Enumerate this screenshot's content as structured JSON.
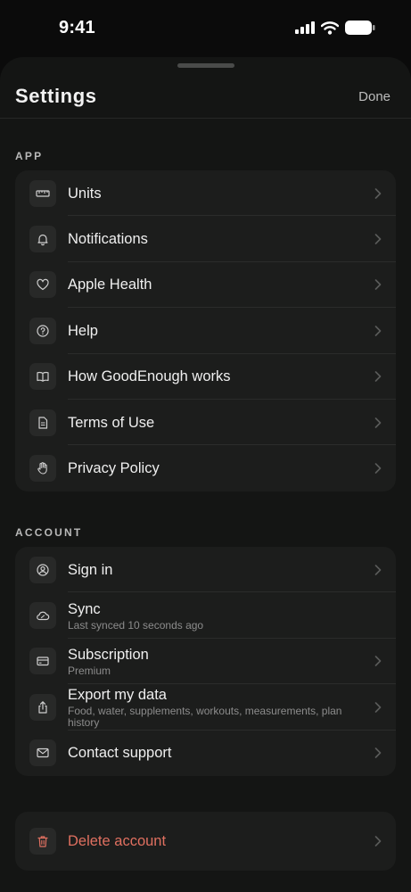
{
  "status": {
    "time": "9:41"
  },
  "header": {
    "title": "Settings",
    "done_label": "Done"
  },
  "sections": {
    "app": {
      "title": "APP",
      "items": [
        {
          "label": "Units",
          "icon": "ruler-icon"
        },
        {
          "label": "Notifications",
          "icon": "bell-icon"
        },
        {
          "label": "Apple Health",
          "icon": "heart-icon"
        },
        {
          "label": "Help",
          "icon": "help-circle-icon"
        },
        {
          "label": "How GoodEnough works",
          "icon": "book-icon"
        },
        {
          "label": "Terms of Use",
          "icon": "document-icon"
        },
        {
          "label": "Privacy Policy",
          "icon": "hand-icon"
        }
      ]
    },
    "account": {
      "title": "ACCOUNT",
      "items": [
        {
          "label": "Sign in",
          "sub": "",
          "icon": "user-circle-icon"
        },
        {
          "label": "Sync",
          "sub": "Last synced 10 seconds ago",
          "icon": "cloud-sync-icon"
        },
        {
          "label": "Subscription",
          "sub": "Premium",
          "icon": "credit-card-icon"
        },
        {
          "label": "Export my data",
          "sub": "Food, water, supplements, workouts, measurements, plan history",
          "icon": "share-icon"
        },
        {
          "label": "Contact support",
          "sub": "",
          "icon": "mail-icon"
        }
      ]
    },
    "danger": {
      "items": [
        {
          "label": "Delete account",
          "icon": "trash-icon"
        }
      ]
    }
  },
  "colors": {
    "danger": "#e07060",
    "background": "#0b0b0b",
    "card": "#1c1d1c"
  }
}
